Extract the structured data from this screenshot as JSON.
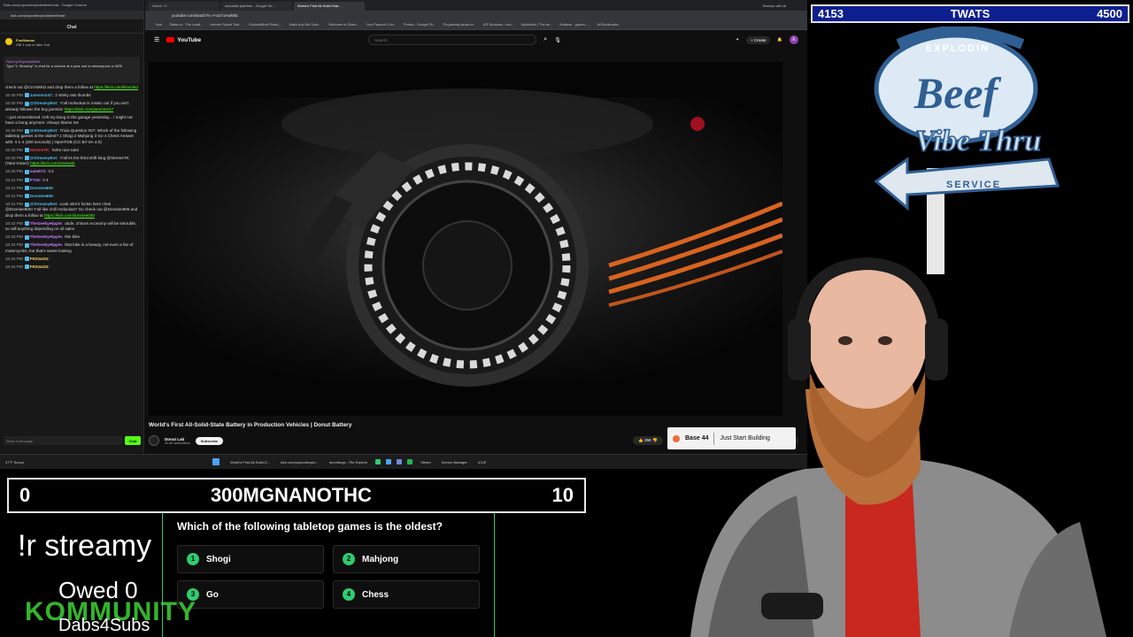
{
  "chat_window": {
    "title": "Kick.com/popout/explodinbeef/chat - Google Chrome",
    "url": "kick.com/popout/explodinbeef/chat",
    "heading": "Chat",
    "gift": {
      "user": "Foolllamaa",
      "text": "Gift 1 sub to take 2nd"
    },
    "pinned": {
      "who": "Sent by ExplodinBeef",
      "text": "Type \"!r Streamy\" in chat for a chance at a year sub to streamy.bot or $25!"
    },
    "top_line": "check out @CmXMKD and drop them a follow at",
    "top_link": "https://kick.com/limxmkd",
    "messages": [
      {
        "time": "10:40 PM",
        "user": "Jammin247:",
        "color": "#53b9e6",
        "text": "2 stinky ass thumbs",
        "link": ""
      },
      {
        "time": "10:40 PM",
        "user": "@StreamyBot:",
        "color": "#53b9e6",
        "text": "Y'all mofuckas is missin out if you ain't already followin the boy jammin!",
        "link": "https://kick.com/jammin247"
      },
      {
        "time": "",
        "user": "",
        "color": "#dddddd",
        "text": ": i just remembered I left my bong in the garage yesterday... I might not have a bong anymore :Always blame me",
        "link": ""
      },
      {
        "time": "10:40 PM",
        "user": "@StreamyBot:",
        "color": "#53b9e6",
        "text": "Trivia Question #27: Which of the following tabletop games is the oldest? 1 Shogi 2 Mahjong 3 Go 4 Chess Answer with: !t 1-4 (300 seconds) | OpenTDB (CC BY-SA 4.0)",
        "link": ""
      },
      {
        "time": "10:40 PM",
        "user": "XtremeTK:",
        "color": "#e84040",
        "text": "hehe nice taint",
        "link": ""
      },
      {
        "time": "10:40 PM",
        "user": "@StreamyBot:",
        "color": "#53b9e6",
        "text": "Y'all its the third shift king @XtremeTK (Taint Kisser)",
        "link": "https://kick.com/xtremetk"
      },
      {
        "time": "10:40 PM",
        "user": "nate674:",
        "color": "#c77dff",
        "text": "!t 2",
        "link": ""
      },
      {
        "time": "10:41 PM",
        "user": "PT28:",
        "color": "#c77dff",
        "text": "!t 4",
        "link": ""
      },
      {
        "time": "10:41 PM",
        "user": "Donniee800:",
        "color": "#53b9e6",
        "text": "",
        "link": ""
      },
      {
        "time": "10:41 PM",
        "user": "Donniee800:",
        "color": "#53b9e6",
        "text": "",
        "link": ""
      },
      {
        "time": "10:41 PM",
        "user": "@StreamyBot:",
        "color": "#53b9e6",
        "text": "Look who's fuckin here chat! @Donniee800! Y'all like chill mofuckas? Go check out @Donniee800 and drop them a follow at",
        "link": "https://kick.com/donnieeb00"
      },
      {
        "time": "10:42 PM",
        "user": "TheGeekyHippie:",
        "color": "#c77dff",
        "text": "dude, china's economy will be introuble, so will anything depending on oil sales",
        "link": ""
      },
      {
        "time": "10:43 PM",
        "user": "TheGeekyHippie:",
        "color": "#c77dff",
        "text": "this bike",
        "link": ""
      },
      {
        "time": "10:44 PM",
        "user": "TheGeekyHippie:",
        "color": "#c77dff",
        "text": "that bike is a beauty, not even a fan of motorcycles, but that's sweet looking",
        "link": ""
      },
      {
        "time": "10:44 PM",
        "user": "FR33at33:",
        "color": "#f0d060",
        "text": "",
        "link": ""
      },
      {
        "time": "10:44 PM",
        "user": "FR33at33:",
        "color": "#f0d060",
        "text": "",
        "link": ""
      }
    ],
    "input_placeholder": "Send a message",
    "send_label": "Chat"
  },
  "browser": {
    "tabs": [
      "Home / X",
      "sunnalist painters - Google Se...",
      "World's First All-Solid-Stat..."
    ],
    "url": "youtube.com/watch?v=Y-a1Y2AwMbc",
    "bookmarks": [
      "Kick",
      "Statsu.in - The Loadi...",
      "Internet Speed Test...",
      "ExplodinBeef Stats |...",
      "Make Any Mic Soun...",
      "Welcome to Okalo...",
      "Your Pepcoin | Dei...",
      "Protect - Google Ph...",
      "Fix gaming issues w...",
      "ICE Boundos - eva...",
      "Mytrobotic | The be...",
      "Andreas - games -...",
      "All Bookmarks"
    ],
    "browse_ai": "Browse with AI"
  },
  "youtube": {
    "logo": "YouTube",
    "search_placeholder": "Search",
    "create_label": "+ Create",
    "avatar_letter": "E",
    "video_title": "World's First All-Solid-State Battery in Production Vehicles | Donut Battery",
    "channel": "Donut Lab",
    "subs": "40.4K subscribers",
    "subscribe": "Subscribe",
    "likes": "25K",
    "share": "Share",
    "ask": "Ask",
    "save": "Save",
    "download": "Download",
    "more": "..."
  },
  "ad": {
    "brand": "Base 44",
    "tagline": "Just Start Building"
  },
  "taskbar": {
    "weather_temp": "37°F",
    "weather_desc": "Sunny",
    "items": [
      "World's First All-Solid-S...",
      "kick.com/popout/explo...",
      "recordings - File Explore",
      "Steam",
      "Device Manager",
      "ICUE"
    ]
  },
  "score_banner": {
    "left": "4153",
    "center": "TWATS",
    "right": "4500"
  },
  "beef_logo": {
    "top": "EXPLODIN",
    "main": "Beef",
    "sub": "Vibe Thru",
    "service": "SERVICE"
  },
  "trivia": {
    "left_score": "0",
    "name": "300MGNANOTHC",
    "right_score": "10",
    "question": "Which of the following tabletop games is the oldest?",
    "answers": [
      {
        "num": "1",
        "text": "Shogi"
      },
      {
        "num": "2",
        "text": "Mahjong"
      },
      {
        "num": "3",
        "text": "Go"
      },
      {
        "num": "4",
        "text": "Chess"
      }
    ]
  },
  "overlay_text": {
    "streamy": "!r streamy",
    "owed": "Owed 0",
    "kommunity": "KOMMUNITY",
    "dabs": "Dabs4Subs"
  },
  "colors": {
    "kick_green": "#53fc18",
    "trivia_green": "#2ecc71",
    "banner_blue": "#0d1f8f",
    "youtube_red": "#ff0000"
  }
}
